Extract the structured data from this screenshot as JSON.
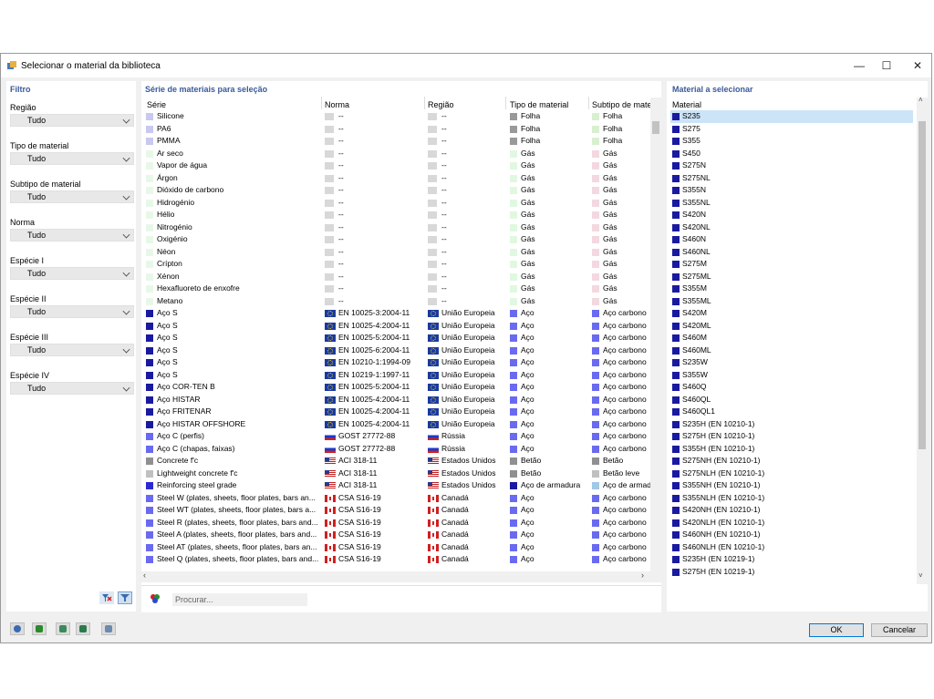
{
  "window": {
    "title": "Selecionar o material da biblioteca"
  },
  "filter": {
    "title": "Filtro",
    "items": [
      {
        "label": "Região",
        "value": "Tudo"
      },
      {
        "label": "Tipo de material",
        "value": "Tudo"
      },
      {
        "label": "Subtipo de material",
        "value": "Tudo"
      },
      {
        "label": "Norma",
        "value": "Tudo"
      },
      {
        "label": "Espécie I",
        "value": "Tudo"
      },
      {
        "label": "Espécie II",
        "value": "Tudo"
      },
      {
        "label": "Espécie III",
        "value": "Tudo"
      },
      {
        "label": "Espécie IV",
        "value": "Tudo"
      }
    ]
  },
  "series": {
    "title": "Série de materiais para seleção",
    "columns": [
      "Série",
      "Norma",
      "Região",
      "Tipo de material",
      "Subtipo de mate"
    ],
    "rows": [
      {
        "serie": "Silicone",
        "c1": "#c8c8f0",
        "norma": "--",
        "nf": "gray",
        "regiao": "--",
        "rf": "gray",
        "tipo": "Folha",
        "tc": "#999999",
        "sub": "Folha",
        "sc": "#d8f0d0"
      },
      {
        "serie": "PA6",
        "c1": "#c8c8f0",
        "norma": "--",
        "nf": "gray",
        "regiao": "--",
        "rf": "gray",
        "tipo": "Folha",
        "tc": "#999999",
        "sub": "Folha",
        "sc": "#d8f0d0"
      },
      {
        "serie": "PMMA",
        "c1": "#c8c8f0",
        "norma": "--",
        "nf": "gray",
        "regiao": "--",
        "rf": "gray",
        "tipo": "Folha",
        "tc": "#999999",
        "sub": "Folha",
        "sc": "#d8f0d0"
      },
      {
        "serie": "Ar seco",
        "c1": "#e8f8e8",
        "norma": "--",
        "nf": "gray",
        "regiao": "--",
        "rf": "gray",
        "tipo": "Gás",
        "tc": "#e0f8e0",
        "sub": "Gás",
        "sc": "#f4d8e0"
      },
      {
        "serie": "Vapor de água",
        "c1": "#e8f8e8",
        "norma": "--",
        "nf": "gray",
        "regiao": "--",
        "rf": "gray",
        "tipo": "Gás",
        "tc": "#e0f8e0",
        "sub": "Gás",
        "sc": "#f4d8e0"
      },
      {
        "serie": "Árgon",
        "c1": "#e8f8e8",
        "norma": "--",
        "nf": "gray",
        "regiao": "--",
        "rf": "gray",
        "tipo": "Gás",
        "tc": "#e0f8e0",
        "sub": "Gás",
        "sc": "#f4d8e0"
      },
      {
        "serie": "Dióxido de carbono",
        "c1": "#e8f8e8",
        "norma": "--",
        "nf": "gray",
        "regiao": "--",
        "rf": "gray",
        "tipo": "Gás",
        "tc": "#e0f8e0",
        "sub": "Gás",
        "sc": "#f4d8e0"
      },
      {
        "serie": "Hidrogénio",
        "c1": "#e8f8e8",
        "norma": "--",
        "nf": "gray",
        "regiao": "--",
        "rf": "gray",
        "tipo": "Gás",
        "tc": "#e0f8e0",
        "sub": "Gás",
        "sc": "#f4d8e0"
      },
      {
        "serie": "Hélio",
        "c1": "#e8f8e8",
        "norma": "--",
        "nf": "gray",
        "regiao": "--",
        "rf": "gray",
        "tipo": "Gás",
        "tc": "#e0f8e0",
        "sub": "Gás",
        "sc": "#f4d8e0"
      },
      {
        "serie": "Nitrogénio",
        "c1": "#e8f8e8",
        "norma": "--",
        "nf": "gray",
        "regiao": "--",
        "rf": "gray",
        "tipo": "Gás",
        "tc": "#e0f8e0",
        "sub": "Gás",
        "sc": "#f4d8e0"
      },
      {
        "serie": "Oxigénio",
        "c1": "#e8f8e8",
        "norma": "--",
        "nf": "gray",
        "regiao": "--",
        "rf": "gray",
        "tipo": "Gás",
        "tc": "#e0f8e0",
        "sub": "Gás",
        "sc": "#f4d8e0"
      },
      {
        "serie": "Néon",
        "c1": "#e8f8e8",
        "norma": "--",
        "nf": "gray",
        "regiao": "--",
        "rf": "gray",
        "tipo": "Gás",
        "tc": "#e0f8e0",
        "sub": "Gás",
        "sc": "#f4d8e0"
      },
      {
        "serie": "Crípton",
        "c1": "#e8f8e8",
        "norma": "--",
        "nf": "gray",
        "regiao": "--",
        "rf": "gray",
        "tipo": "Gás",
        "tc": "#e0f8e0",
        "sub": "Gás",
        "sc": "#f4d8e0"
      },
      {
        "serie": "Xénon",
        "c1": "#e8f8e8",
        "norma": "--",
        "nf": "gray",
        "regiao": "--",
        "rf": "gray",
        "tipo": "Gás",
        "tc": "#e0f8e0",
        "sub": "Gás",
        "sc": "#f4d8e0"
      },
      {
        "serie": "Hexafluoreto de enxofre",
        "c1": "#e8f8e8",
        "norma": "--",
        "nf": "gray",
        "regiao": "--",
        "rf": "gray",
        "tipo": "Gás",
        "tc": "#e0f8e0",
        "sub": "Gás",
        "sc": "#f4d8e0"
      },
      {
        "serie": "Metano",
        "c1": "#e8f8e8",
        "norma": "--",
        "nf": "gray",
        "regiao": "--",
        "rf": "gray",
        "tipo": "Gás",
        "tc": "#e0f8e0",
        "sub": "Gás",
        "sc": "#f4d8e0"
      },
      {
        "serie": "Aço S",
        "c1": "#1a1aa0",
        "norma": "EN 10025-3:2004-11",
        "nf": "eu",
        "regiao": "União Europeia",
        "rf": "eu",
        "tipo": "Aço",
        "tc": "#6a6af0",
        "sub": "Aço carbono",
        "sc": "#6a6af0"
      },
      {
        "serie": "Aço S",
        "c1": "#1a1aa0",
        "norma": "EN 10025-4:2004-11",
        "nf": "eu",
        "regiao": "União Europeia",
        "rf": "eu",
        "tipo": "Aço",
        "tc": "#6a6af0",
        "sub": "Aço carbono",
        "sc": "#6a6af0"
      },
      {
        "serie": "Aço S",
        "c1": "#1a1aa0",
        "norma": "EN 10025-5:2004-11",
        "nf": "eu",
        "regiao": "União Europeia",
        "rf": "eu",
        "tipo": "Aço",
        "tc": "#6a6af0",
        "sub": "Aço carbono",
        "sc": "#6a6af0"
      },
      {
        "serie": "Aço S",
        "c1": "#1a1aa0",
        "norma": "EN 10025-6:2004-11",
        "nf": "eu",
        "regiao": "União Europeia",
        "rf": "eu",
        "tipo": "Aço",
        "tc": "#6a6af0",
        "sub": "Aço carbono",
        "sc": "#6a6af0"
      },
      {
        "serie": "Aço S",
        "c1": "#1a1aa0",
        "norma": "EN 10210-1:1994-09",
        "nf": "eu",
        "regiao": "União Europeia",
        "rf": "eu",
        "tipo": "Aço",
        "tc": "#6a6af0",
        "sub": "Aço carbono",
        "sc": "#6a6af0"
      },
      {
        "serie": "Aço S",
        "c1": "#1a1aa0",
        "norma": "EN 10219-1:1997-11",
        "nf": "eu",
        "regiao": "União Europeia",
        "rf": "eu",
        "tipo": "Aço",
        "tc": "#6a6af0",
        "sub": "Aço carbono",
        "sc": "#6a6af0"
      },
      {
        "serie": "Aço COR-TEN B",
        "c1": "#1a1aa0",
        "norma": "EN 10025-5:2004-11",
        "nf": "eu",
        "regiao": "União Europeia",
        "rf": "eu",
        "tipo": "Aço",
        "tc": "#6a6af0",
        "sub": "Aço carbono",
        "sc": "#6a6af0"
      },
      {
        "serie": "Aço HISTAR",
        "c1": "#1a1aa0",
        "norma": "EN 10025-4:2004-11",
        "nf": "eu",
        "regiao": "União Europeia",
        "rf": "eu",
        "tipo": "Aço",
        "tc": "#6a6af0",
        "sub": "Aço carbono",
        "sc": "#6a6af0"
      },
      {
        "serie": "Aço FRITENAR",
        "c1": "#1a1aa0",
        "norma": "EN 10025-4:2004-11",
        "nf": "eu",
        "regiao": "União Europeia",
        "rf": "eu",
        "tipo": "Aço",
        "tc": "#6a6af0",
        "sub": "Aço carbono",
        "sc": "#6a6af0"
      },
      {
        "serie": "Aço HISTAR OFFSHORE",
        "c1": "#1a1aa0",
        "norma": "EN 10025-4:2004-11",
        "nf": "eu",
        "regiao": "União Europeia",
        "rf": "eu",
        "tipo": "Aço",
        "tc": "#6a6af0",
        "sub": "Aço carbono",
        "sc": "#6a6af0"
      },
      {
        "serie": "Aço C (perfis)",
        "c1": "#6a6af0",
        "norma": "GOST 27772-88",
        "nf": "ru",
        "regiao": "Rússia",
        "rf": "ru",
        "tipo": "Aço",
        "tc": "#6a6af0",
        "sub": "Aço carbono",
        "sc": "#6a6af0"
      },
      {
        "serie": "Aço C (chapas, faixas)",
        "c1": "#6a6af0",
        "norma": "GOST 27772-88",
        "nf": "ru",
        "regiao": "Rússia",
        "rf": "ru",
        "tipo": "Aço",
        "tc": "#6a6af0",
        "sub": "Aço carbono",
        "sc": "#6a6af0"
      },
      {
        "serie": "Concrete f'c",
        "c1": "#909090",
        "norma": "ACI 318-11",
        "nf": "us",
        "regiao": "Estados Unidos",
        "rf": "us",
        "tipo": "Betão",
        "tc": "#909090",
        "sub": "Betão",
        "sc": "#909090"
      },
      {
        "serie": "Lightweight concrete f'c",
        "c1": "#c0c0c0",
        "norma": "ACI 318-11",
        "nf": "us",
        "regiao": "Estados Unidos",
        "rf": "us",
        "tipo": "Betão",
        "tc": "#909090",
        "sub": "Betão leve",
        "sc": "#c0c0c0"
      },
      {
        "serie": "Reinforcing steel grade",
        "c1": "#2a2ad0",
        "norma": "ACI 318-11",
        "nf": "us",
        "regiao": "Estados Unidos",
        "rf": "us",
        "tipo": "Aço de armadura",
        "tc": "#1a1aa0",
        "sub": "Aço de armad",
        "sc": "#a0c8e8"
      },
      {
        "serie": "Steel W (plates, sheets, floor plates, bars an...",
        "c1": "#6a6af0",
        "norma": "CSA S16-19",
        "nf": "ca",
        "regiao": "Canadá",
        "rf": "ca",
        "tipo": "Aço",
        "tc": "#6a6af0",
        "sub": "Aço carbono",
        "sc": "#6a6af0"
      },
      {
        "serie": "Steel WT (plates, sheets, floor plates, bars a...",
        "c1": "#6a6af0",
        "norma": "CSA S16-19",
        "nf": "ca",
        "regiao": "Canadá",
        "rf": "ca",
        "tipo": "Aço",
        "tc": "#6a6af0",
        "sub": "Aço carbono",
        "sc": "#6a6af0"
      },
      {
        "serie": "Steel R (plates, sheets, floor plates, bars and...",
        "c1": "#6a6af0",
        "norma": "CSA S16-19",
        "nf": "ca",
        "regiao": "Canadá",
        "rf": "ca",
        "tipo": "Aço",
        "tc": "#6a6af0",
        "sub": "Aço carbono",
        "sc": "#6a6af0"
      },
      {
        "serie": "Steel A (plates, sheets, floor plates, bars and...",
        "c1": "#6a6af0",
        "norma": "CSA S16-19",
        "nf": "ca",
        "regiao": "Canadá",
        "rf": "ca",
        "tipo": "Aço",
        "tc": "#6a6af0",
        "sub": "Aço carbono",
        "sc": "#6a6af0"
      },
      {
        "serie": "Steel AT (plates, sheets, floor plates, bars an...",
        "c1": "#6a6af0",
        "norma": "CSA S16-19",
        "nf": "ca",
        "regiao": "Canadá",
        "rf": "ca",
        "tipo": "Aço",
        "tc": "#6a6af0",
        "sub": "Aço carbono",
        "sc": "#6a6af0"
      },
      {
        "serie": "Steel Q (plates, sheets, floor plates, bars and...",
        "c1": "#6a6af0",
        "norma": "CSA S16-19",
        "nf": "ca",
        "regiao": "Canadá",
        "rf": "ca",
        "tipo": "Aço",
        "tc": "#6a6af0",
        "sub": "Aço carbono",
        "sc": "#6a6af0"
      }
    ]
  },
  "materials": {
    "title": "Material a selecionar",
    "column": "Material",
    "items": [
      {
        "name": "S235",
        "c": "#1a1aa0"
      },
      {
        "name": "S275",
        "c": "#1a1aa0"
      },
      {
        "name": "S355",
        "c": "#1a1aa0"
      },
      {
        "name": "S450",
        "c": "#1a1aa0"
      },
      {
        "name": "S275N",
        "c": "#1a1aa0"
      },
      {
        "name": "S275NL",
        "c": "#1a1aa0"
      },
      {
        "name": "S355N",
        "c": "#1a1aa0"
      },
      {
        "name": "S355NL",
        "c": "#1a1aa0"
      },
      {
        "name": "S420N",
        "c": "#1a1aa0"
      },
      {
        "name": "S420NL",
        "c": "#1a1aa0"
      },
      {
        "name": "S460N",
        "c": "#1a1aa0"
      },
      {
        "name": "S460NL",
        "c": "#1a1aa0"
      },
      {
        "name": "S275M",
        "c": "#1a1aa0"
      },
      {
        "name": "S275ML",
        "c": "#1a1aa0"
      },
      {
        "name": "S355M",
        "c": "#1a1aa0"
      },
      {
        "name": "S355ML",
        "c": "#1a1aa0"
      },
      {
        "name": "S420M",
        "c": "#1a1aa0"
      },
      {
        "name": "S420ML",
        "c": "#1a1aa0"
      },
      {
        "name": "S460M",
        "c": "#1a1aa0"
      },
      {
        "name": "S460ML",
        "c": "#1a1aa0"
      },
      {
        "name": "S235W",
        "c": "#1a1aa0"
      },
      {
        "name": "S355W",
        "c": "#1a1aa0"
      },
      {
        "name": "S460Q",
        "c": "#1a1aa0"
      },
      {
        "name": "S460QL",
        "c": "#1a1aa0"
      },
      {
        "name": "S460QL1",
        "c": "#1a1aa0"
      },
      {
        "name": "S235H (EN 10210-1)",
        "c": "#1a1aa0"
      },
      {
        "name": "S275H (EN 10210-1)",
        "c": "#1a1aa0"
      },
      {
        "name": "S355H (EN 10210-1)",
        "c": "#1a1aa0"
      },
      {
        "name": "S275NH (EN 10210-1)",
        "c": "#1a1aa0"
      },
      {
        "name": "S275NLH (EN 10210-1)",
        "c": "#1a1aa0"
      },
      {
        "name": "S355NH (EN 10210-1)",
        "c": "#1a1aa0"
      },
      {
        "name": "S355NLH (EN 10210-1)",
        "c": "#1a1aa0"
      },
      {
        "name": "S420NH (EN 10210-1)",
        "c": "#1a1aa0"
      },
      {
        "name": "S420NLH (EN 10210-1)",
        "c": "#1a1aa0"
      },
      {
        "name": "S460NH (EN 10210-1)",
        "c": "#1a1aa0"
      },
      {
        "name": "S460NLH (EN 10210-1)",
        "c": "#1a1aa0"
      },
      {
        "name": "S235H (EN 10219-1)",
        "c": "#1a1aa0"
      },
      {
        "name": "S275H (EN 10219-1)",
        "c": "#1a1aa0"
      }
    ]
  },
  "search": {
    "placeholder": "Procurar..."
  },
  "buttons": {
    "ok": "OK",
    "cancel": "Cancelar"
  },
  "icons": {
    "app": "material-library-icon",
    "close": "✕",
    "maximize": "☐",
    "minimize": "—"
  }
}
